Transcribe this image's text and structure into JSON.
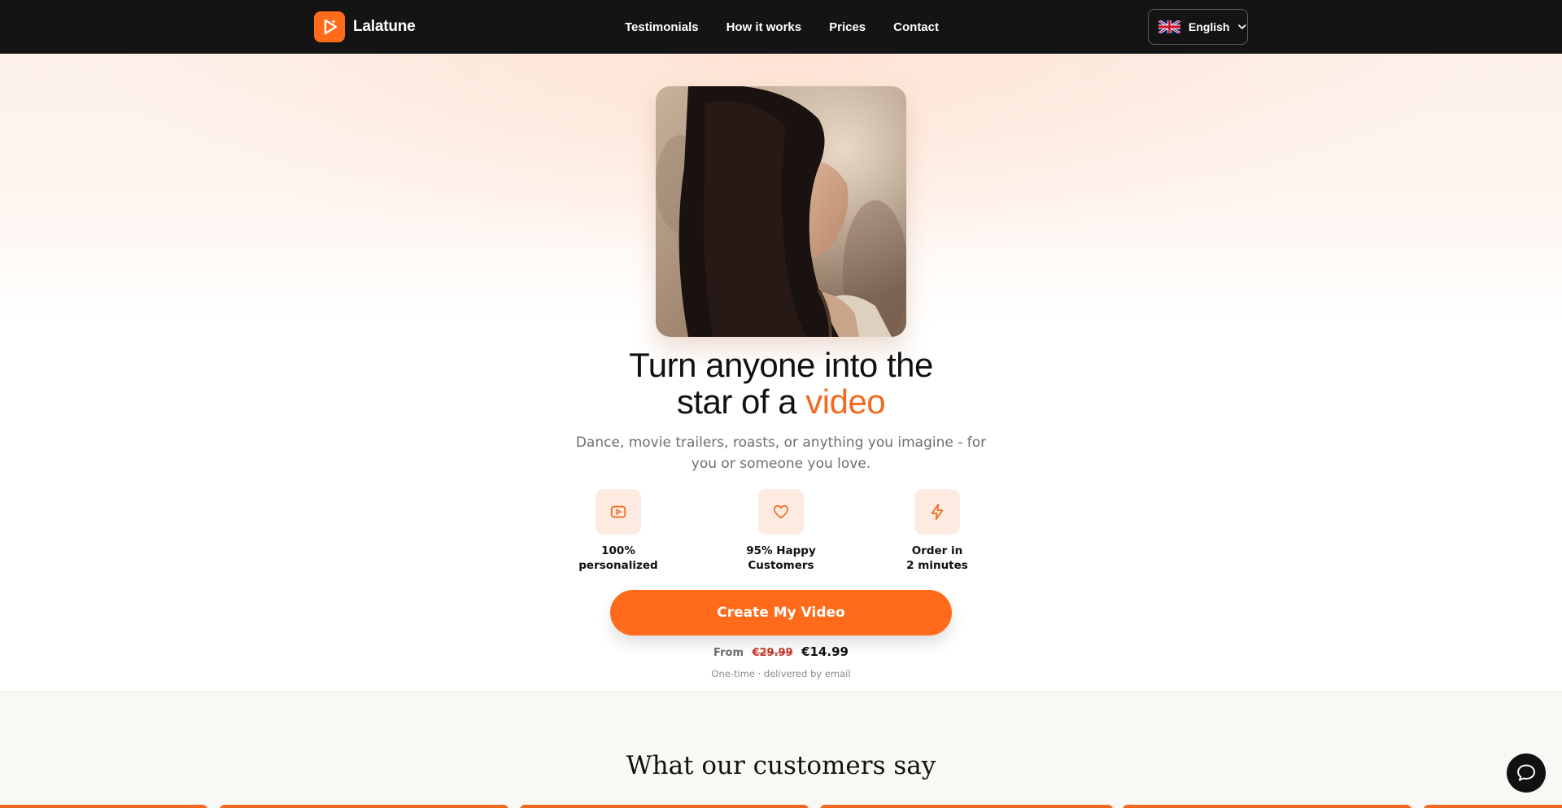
{
  "brand": {
    "name": "Lalatune",
    "logo_icon": "play-icon"
  },
  "nav": {
    "links": [
      "Testimonials",
      "How it works",
      "Prices",
      "Contact"
    ]
  },
  "language": {
    "label": "English",
    "flag": "uk-flag-icon"
  },
  "hero": {
    "title_part1": "Turn anyone into the",
    "title_part2": "star of a",
    "title_accent": "video",
    "subtitle": "Dance, movie trailers, roasts, or anything you imagine - for you or someone you love.",
    "features": [
      {
        "icon": "play-square-icon",
        "line1": "100%",
        "line2": "personalized"
      },
      {
        "icon": "heart-icon",
        "line1": "95% Happy",
        "line2": "Customers"
      },
      {
        "icon": "lightning-icon",
        "line1": "Order in",
        "line2": "2 minutes"
      }
    ],
    "cta_label": "Create My Video",
    "price": {
      "from": "From",
      "old": "€29.99",
      "new": "€14.99"
    },
    "price_note": "One-time · delivered by email"
  },
  "testimonials": {
    "title": "What our customers say"
  },
  "colors": {
    "accent": "#ff6b1a",
    "nav_bg": "#141414",
    "feature_bg": "#fdebe1"
  },
  "chat": {
    "icon": "chat-bubble-icon"
  }
}
